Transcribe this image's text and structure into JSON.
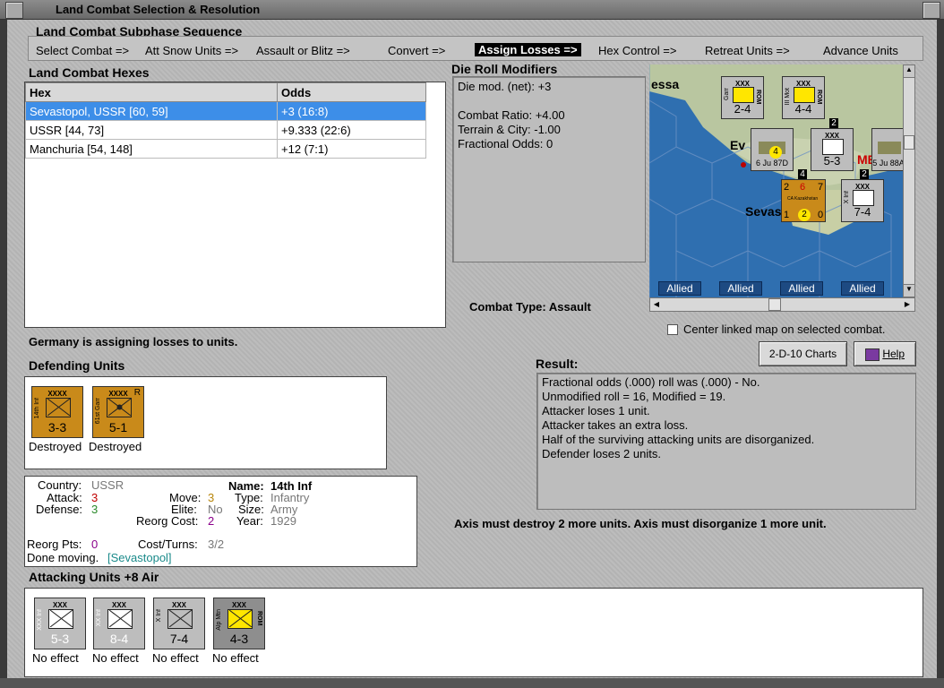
{
  "window": {
    "title": "Land Combat Selection & Resolution"
  },
  "subphase": {
    "title": "Land Combat Subphase Sequence",
    "steps": [
      "Select Combat =>",
      "Att Snow Units =>",
      "Assault or Blitz =>",
      "Convert =>",
      "Assign Losses =>",
      "Hex Control =>",
      "Retreat Units =>",
      "Advance Units"
    ],
    "active_index": 4
  },
  "hexes": {
    "title": "Land Combat Hexes",
    "columns": [
      "Hex",
      "Odds"
    ],
    "rows": [
      {
        "hex": "Sevastopol, USSR [60, 59]",
        "odds": "+3 (16:8)"
      },
      {
        "hex": "USSR [44, 73]",
        "odds": "+9.333 (22:6)"
      },
      {
        "hex": "Manchuria [54, 148]",
        "odds": "+12 (7:1)"
      }
    ]
  },
  "die_roll": {
    "title": "Die Roll Modifiers",
    "lines": [
      "Die mod. (net): +3",
      "",
      "Combat Ratio: +4.00",
      "Terrain & City: -1.00",
      "Fractional Odds: 0"
    ]
  },
  "combat_type": {
    "label": "Combat Type:",
    "value": "Assault"
  },
  "map": {
    "labels": [
      "essa",
      "Ev",
      "ME",
      "Sevas"
    ],
    "bottom_tags": [
      "Allied",
      "Allied",
      "Allied",
      "Allied"
    ],
    "counters": [
      {
        "size": "XXX",
        "str": "2-4",
        "side": "ROM",
        "name": "Garr",
        "color": "grey"
      },
      {
        "size": "XXX",
        "str": "4-4",
        "side": "ROM",
        "name": "III Mot",
        "color": "grey"
      },
      {
        "size": "XXX",
        "str": "5-3",
        "side": "",
        "name": "",
        "color": "grey"
      },
      {
        "size": "XXX",
        "str": "7-4",
        "side": "",
        "name": "X Inf",
        "color": "grey"
      },
      {
        "size": "",
        "str": "6",
        "side": "",
        "name": "Ju 87D",
        "color": "grey"
      },
      {
        "size": "",
        "str": "5",
        "side": "",
        "name": "Ju 88A",
        "color": "grey"
      }
    ],
    "air_badge": "4",
    "stack_badges": [
      "2",
      "4",
      "2"
    ],
    "gold_counter": {
      "left": "2",
      "mid": "6",
      "right": "7",
      "bottom_l": "1",
      "bottom_c": "2",
      "bottom_r": "0",
      "name": "CA Kazakhstan"
    }
  },
  "center_checkbox": {
    "label": "Center linked map on selected combat.",
    "checked": false
  },
  "buttons": {
    "charts": "2-D-10 Charts",
    "help": "Help"
  },
  "assigning_msg": "Germany is assigning losses to units.",
  "defending": {
    "title": "Defending Units",
    "units": [
      {
        "size": "XXXX",
        "str": "3-3",
        "name": "14th Inf",
        "status": "Destroyed",
        "tag": ""
      },
      {
        "size": "XXXX",
        "str": "5-1",
        "name": "61st Garr",
        "status": "Destroyed",
        "tag": "R"
      }
    ]
  },
  "result": {
    "title": "Result:",
    "lines": [
      "Fractional odds (.000) roll was (.000)  - No.",
      "Unmodified roll = 16, Modified = 19.",
      "Attacker loses 1 unit.",
      "Attacker takes an extra loss.",
      "Half of the surviving attacking units are disorganized.",
      "Defender loses 2 units."
    ]
  },
  "axis_msg": "Axis must destroy 2 more units. Axis must disorganize 1 more unit.",
  "unit_info": {
    "country_label": "Country:",
    "country": "USSR",
    "attack_label": "Attack:",
    "attack": "3",
    "defense_label": "Defense:",
    "defense": "3",
    "name_label": "Name:",
    "name": "14th Inf",
    "move_label": "Move:",
    "move": "3",
    "type_label": "Type:",
    "type": "Infantry",
    "elite_label": "Elite:",
    "elite": "No",
    "size_label": "Size:",
    "size": "Army",
    "reorg_cost_label": "Reorg Cost:",
    "reorg_cost": "2",
    "year_label": "Year:",
    "year": "1929",
    "reorg_pts_label": "Reorg Pts:",
    "reorg_pts": "0",
    "cost_turns_label": "Cost/Turns:",
    "cost_turns": "3/2",
    "done_label": "Done moving.",
    "done_loc": "[Sevastopol]"
  },
  "attacking": {
    "title": "Attacking Units +8 Air",
    "units": [
      {
        "size": "XXX",
        "str": "5-3",
        "name": "XXX Inf",
        "status": "No effect",
        "color": "grey",
        "side": ""
      },
      {
        "size": "XXX",
        "str": "8-4",
        "name": "XX Inf",
        "status": "No effect",
        "color": "grey",
        "side": ""
      },
      {
        "size": "XXX",
        "str": "7-4",
        "name": "X Inf",
        "status": "No effect",
        "color": "grey",
        "side": ""
      },
      {
        "size": "XXX",
        "str": "4-3",
        "name": "Alp Mtn",
        "status": "No effect",
        "color": "dgrey",
        "side": "ROM"
      }
    ]
  },
  "colors": {
    "selected_row": "#3d8ee8",
    "unit_gold": "#c98a1a",
    "map_sea": "#2f6fb0"
  }
}
